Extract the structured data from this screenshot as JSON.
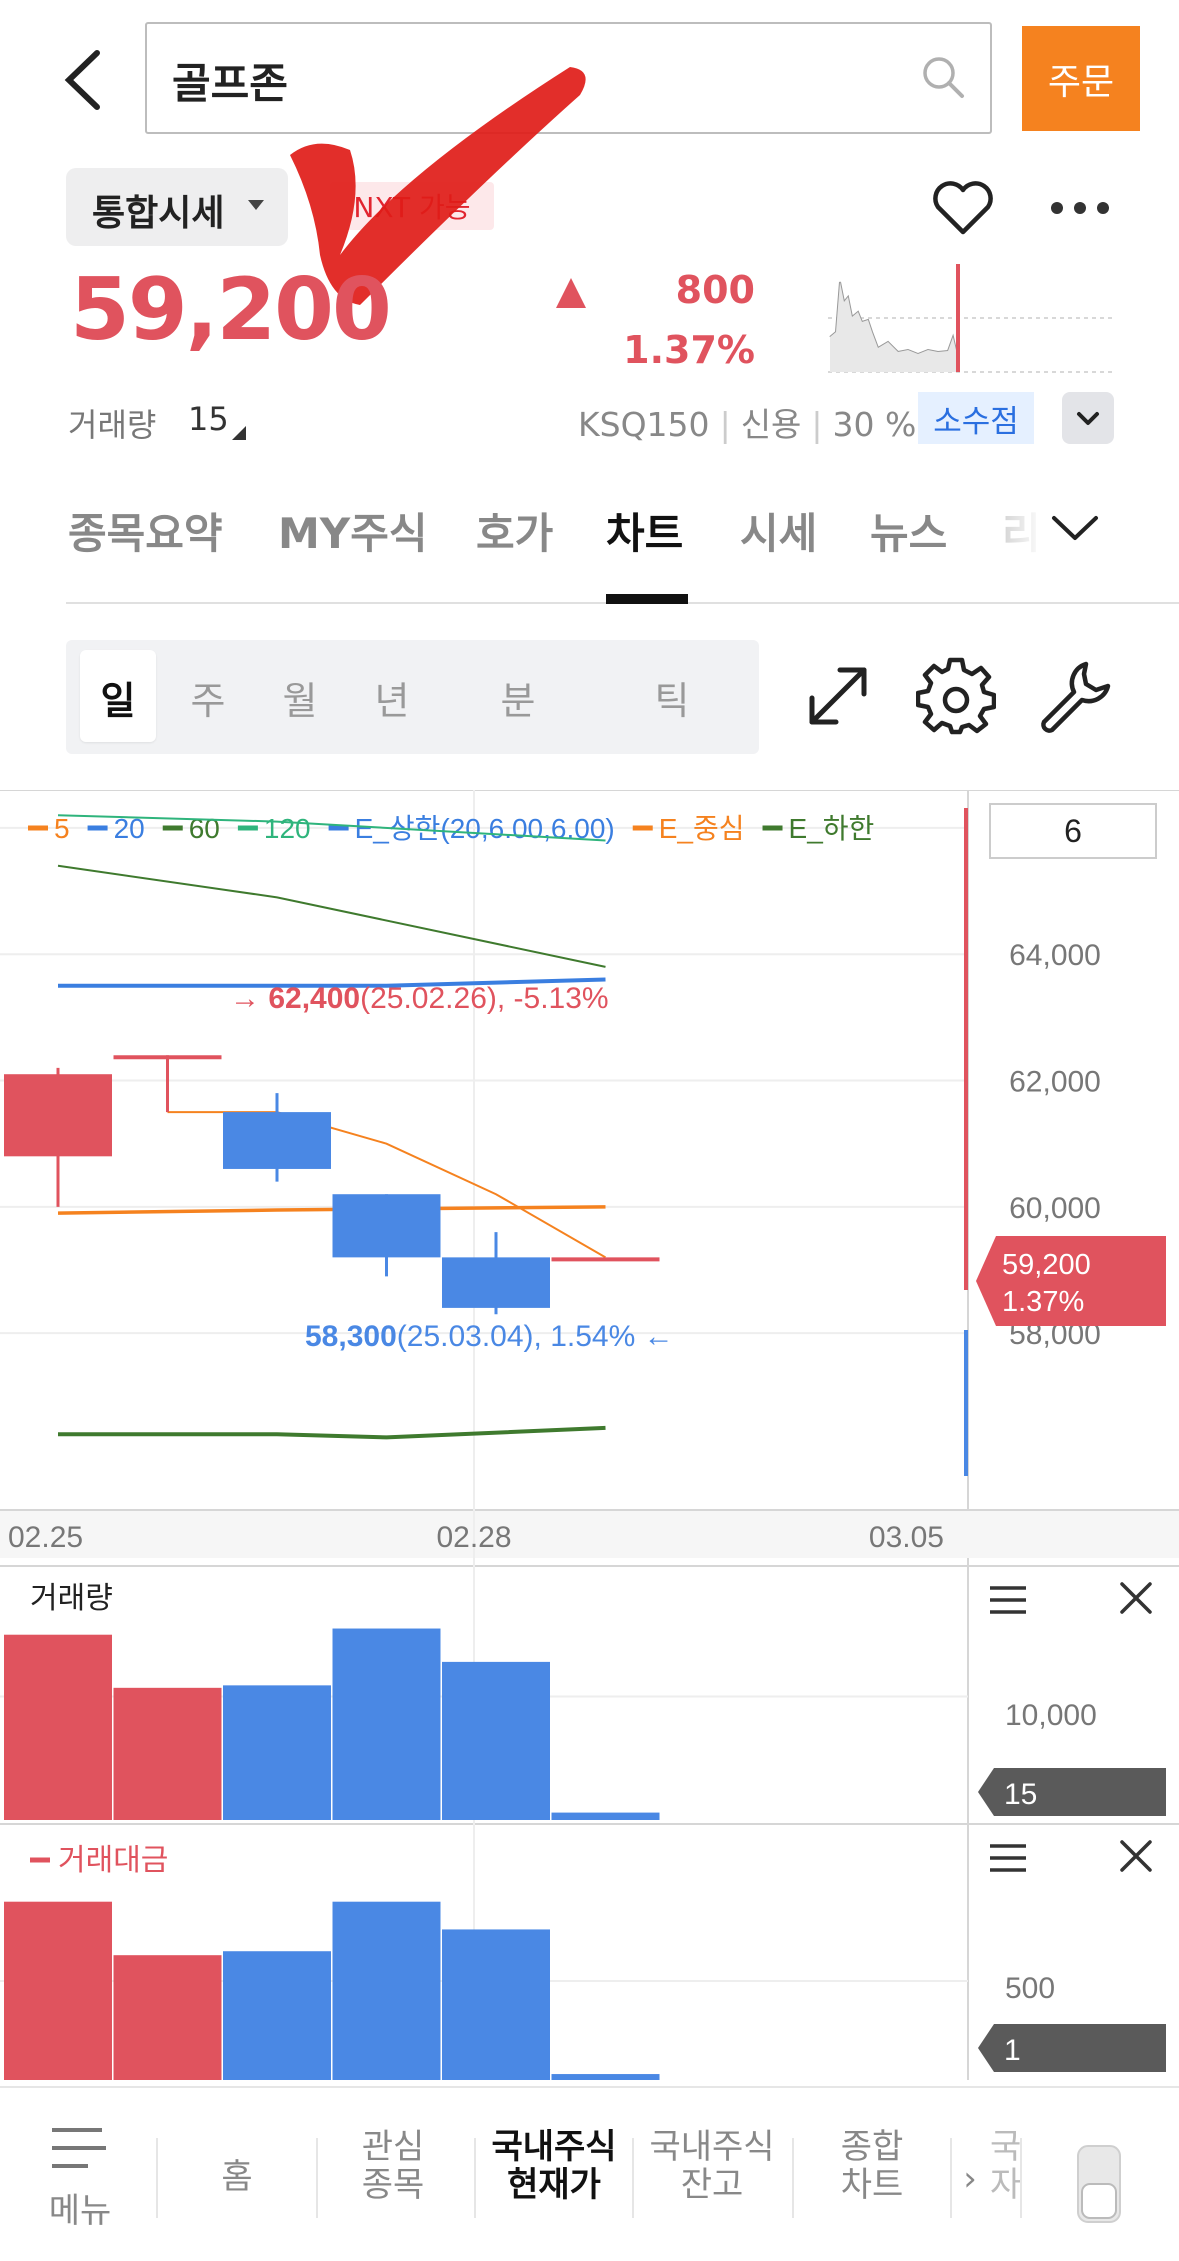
{
  "header": {
    "search_value": "골프존",
    "order_label": "주문"
  },
  "stock": {
    "segment_label": "통합시세",
    "nxt_label": "NXT 가능",
    "price": "59,200",
    "change_amount": "800",
    "change_percent": "1.37%",
    "volume_label": "거래량",
    "volume_value": "15",
    "index_name": "KSQ150",
    "credit_label": "신용",
    "credit_value": "30 %",
    "decimal_label": "소수점"
  },
  "tabs": [
    {
      "label": "종목요약"
    },
    {
      "label": "MY주식"
    },
    {
      "label": "호가"
    },
    {
      "label": "차트"
    },
    {
      "label": "시세"
    },
    {
      "label": "뉴스"
    },
    {
      "label": "리"
    }
  ],
  "periods": [
    {
      "label": "일"
    },
    {
      "label": "주"
    },
    {
      "label": "월"
    },
    {
      "label": "년"
    },
    {
      "label": "분"
    },
    {
      "label": "틱"
    }
  ],
  "chart": {
    "count_box": "6",
    "legend": [
      {
        "label": "5",
        "color": "#f5821f"
      },
      {
        "label": "20",
        "color": "#3a7ee0"
      },
      {
        "label": "60",
        "color": "#3f7a2e"
      },
      {
        "label": "120",
        "color": "#2fb47c"
      },
      {
        "label": "E_상한(20,6.00,6.00)",
        "color": "#3a7ee0"
      },
      {
        "label": "E_중심",
        "color": "#f5821f"
      },
      {
        "label": "E_하한",
        "color": "#3f7a2e"
      }
    ],
    "high_annotation_value": "62,400",
    "high_annotation_rest": "(25.02.26), -5.13%",
    "low_annotation_value": "58,300",
    "low_annotation_rest": "(25.03.04), 1.54%",
    "current_tag_price": "59,200",
    "current_tag_pct": "1.37%",
    "x_labels": [
      "02.25",
      "02.28",
      "03.05"
    ],
    "volume_title": "거래량",
    "volume_axis_label": "10,000",
    "volume_tag": "15",
    "amount_title": "거래대금",
    "amount_axis_label": "500",
    "amount_tag": "1",
    "colors": {
      "up": "#e0535e",
      "down": "#4a88e4"
    }
  },
  "chart_data": {
    "type": "candlestick",
    "y_ticks": [
      66000,
      64000,
      62000,
      60000,
      58000
    ],
    "ylim": [
      55200,
      66600
    ],
    "candles": [
      {
        "open": 60800,
        "high": 62200,
        "low": 60000,
        "close": 62100,
        "dir": "up"
      },
      {
        "open": 62400,
        "high": 62400,
        "low": 61500,
        "close": 62400,
        "dir": "up"
      },
      {
        "open": 61500,
        "high": 61800,
        "low": 60400,
        "close": 60600,
        "dir": "down"
      },
      {
        "open": 60200,
        "high": 60200,
        "low": 58900,
        "close": 59200,
        "dir": "down"
      },
      {
        "open": 59200,
        "high": 59600,
        "low": 58300,
        "close": 58400,
        "dir": "down"
      },
      {
        "open": 59200,
        "high": 59200,
        "low": 59200,
        "close": 59200,
        "dir": "up"
      }
    ],
    "series": [
      {
        "name": "5",
        "values": [
          null,
          61500,
          61500,
          61000,
          60200,
          59200
        ]
      },
      {
        "name": "120",
        "values": [
          66200,
          null,
          66100,
          null,
          null,
          65800
        ]
      },
      {
        "name": "60",
        "values": [
          65400,
          null,
          64900,
          null,
          null,
          63800
        ]
      },
      {
        "name": "E_상한(20,6.00,6.00)",
        "values": [
          63500,
          null,
          63500,
          63500,
          null,
          63600
        ]
      },
      {
        "name": "E_중심",
        "values": [
          59900,
          null,
          59950,
          null,
          null,
          60000
        ]
      },
      {
        "name": "E_하한",
        "values": [
          56400,
          null,
          56400,
          56350,
          null,
          56500
        ]
      }
    ],
    "volume": [
      15000,
      10700,
      10900,
      15500,
      12800,
      600
    ],
    "amount": [
      900,
      630,
      650,
      900,
      760,
      30
    ]
  }
}
